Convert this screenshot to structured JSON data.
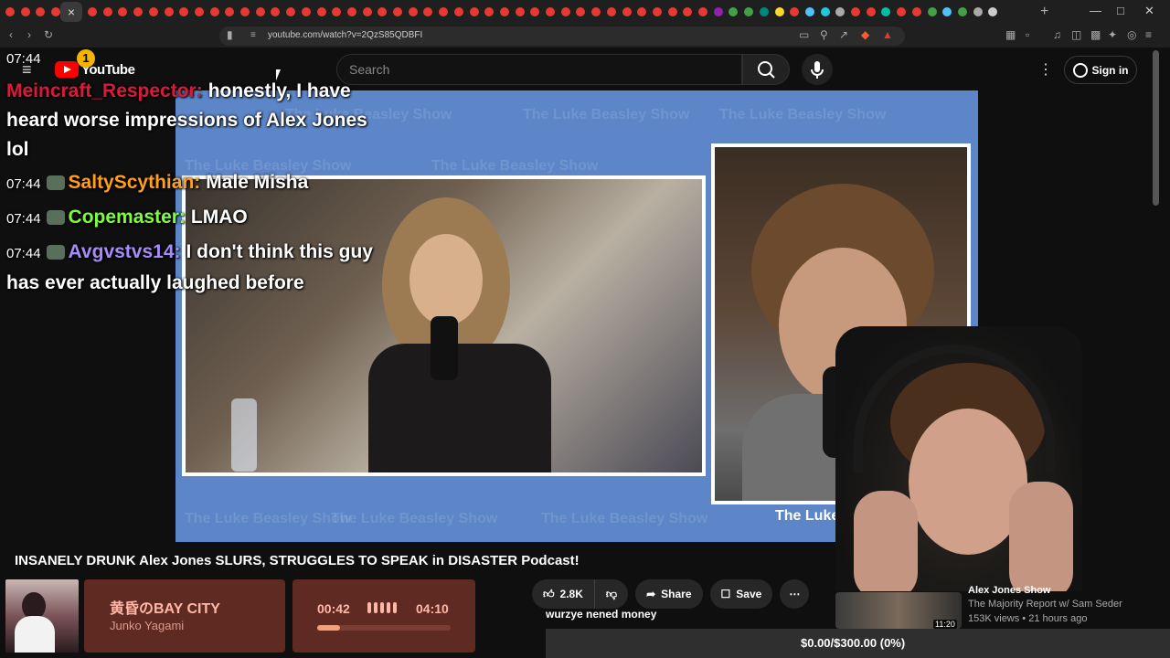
{
  "browser": {
    "url": "youtube.com/watch?v=2QzS85QDBFI",
    "tab_colors": [
      "#e53935",
      "#e53935",
      "#e53935",
      "#e53935",
      "#e53935",
      "#e53935",
      "#e53935",
      "#e53935",
      "#e53935",
      "#e53935",
      "#e53935",
      "#e53935",
      "#e53935",
      "#e53935",
      "#e53935",
      "#e53935",
      "#e53935",
      "#e53935",
      "#e53935",
      "#e53935",
      "#e53935",
      "#e53935",
      "#e53935",
      "#e53935",
      "#e53935",
      "#e53935",
      "#e53935",
      "#e53935",
      "#e53935",
      "#e53935",
      "#e53935",
      "#e53935",
      "#e53935",
      "#e53935",
      "#e53935",
      "#e53935",
      "#e53935",
      "#e53935",
      "#e53935",
      "#e53935",
      "#e53935",
      "#e53935",
      "#e53935",
      "#e53935",
      "#e53935",
      "#8e24aa",
      "#43a047",
      "#43a047",
      "#00897b",
      "#fdd835",
      "#e53935",
      "#4fc3f7",
      "#26c6da",
      "#aaaaaa",
      "#e53935",
      "#e53935",
      "#00bfa5",
      "#e53935",
      "#e53935",
      "#43a047",
      "#4fc3f7",
      "#43a047",
      "#aaaaaa",
      "#cccccc"
    ],
    "close_tab_glyph": "×",
    "new_tab_glyph": "+"
  },
  "header": {
    "logo_text": "YouTube",
    "search_placeholder": "Search",
    "signin_label": "Sign in",
    "notification_count": "1"
  },
  "chat": [
    {
      "time": "07:44",
      "user": "Meincraft_Respector:",
      "user_color": "#d81b3c",
      "message": "honestly, I have heard worse impressions of Alex Jones lol",
      "has_emote": false
    },
    {
      "time": "07:44",
      "user": "SaltyScythian:",
      "user_color": "#ff9f1a",
      "message": "Male Misha",
      "has_emote": true
    },
    {
      "time": "07:44",
      "user": "Copemaster:",
      "user_color": "#7cff3a",
      "message": "LMAO",
      "has_emote": true
    },
    {
      "time": "07:44",
      "user": "Avgvstvs14:",
      "user_color": "#a78bfa",
      "message": "I don't think this guy has ever actually laughed before",
      "has_emote": true
    }
  ],
  "video": {
    "watermark_text": "The Luke Beasley Show",
    "brand_label": "The Luke"
  },
  "info": {
    "title": "INSANELY DRUNK Alex Jones SLURS, STRUGGLES TO SPEAK in DISASTER Podcast!",
    "likes": "2.8K",
    "share_label": "Share",
    "save_label": "Save",
    "comment_text": "wurzye nened money"
  },
  "music": {
    "title": "黄昏のBAY CITY",
    "artist": "Junko Yagami",
    "current_time": "00:42",
    "duration": "04:10",
    "progress": 0.17
  },
  "suggestion": {
    "title": "Alex Jones Show",
    "channel": "The Majority Report w/ Sam Seder",
    "meta": "153K views • 21 hours ago",
    "duration": "11:20"
  },
  "donation": {
    "text": "$0.00/$300.00 (0%)"
  }
}
